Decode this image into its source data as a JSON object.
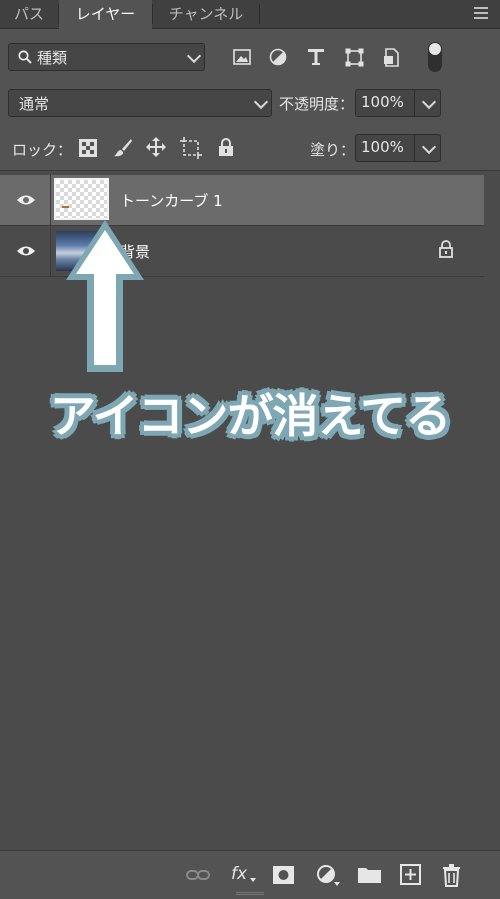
{
  "tabs": [
    {
      "label": "パス",
      "active": false
    },
    {
      "label": "レイヤー",
      "active": true
    },
    {
      "label": "チャンネル",
      "active": false
    }
  ],
  "filter": {
    "kind_label": "種類",
    "filter_icons": [
      "image-filter-icon",
      "adjustment-filter-icon",
      "type-filter-icon",
      "shape-filter-icon",
      "smart-object-filter-icon",
      "filter-toggle-icon"
    ]
  },
  "blend": {
    "mode": "通常",
    "opacity_label": "不透明度：",
    "opacity_value": "100%"
  },
  "lock": {
    "label": "ロック：",
    "icons": [
      "lock-transparent-pixels-icon",
      "lock-image-pixels-icon",
      "lock-position-icon",
      "lock-artboard-icon",
      "lock-all-icon"
    ],
    "fill_label": "塗り：",
    "fill_value": "100%"
  },
  "layers": [
    {
      "name": "トーンカーブ 1",
      "selected": true,
      "visible": true,
      "locked": false
    },
    {
      "name": "背景",
      "selected": false,
      "visible": true,
      "locked": true
    }
  ],
  "annotation": {
    "text": "アイコンが消えてる",
    "stroke_color": "#7ea7b4"
  },
  "bottom_bar": {
    "icons": [
      "link-layers-icon",
      "layer-style-fx-icon",
      "add-mask-icon",
      "new-adjustment-layer-icon",
      "new-group-folder-icon",
      "new-layer-icon",
      "delete-layer-icon"
    ],
    "fx_label": "fx"
  },
  "colors": {
    "panel": "#535353",
    "layers_bg": "#4b4b4b",
    "selected_row": "#6b6b6b",
    "tab_bar": "#404040"
  }
}
